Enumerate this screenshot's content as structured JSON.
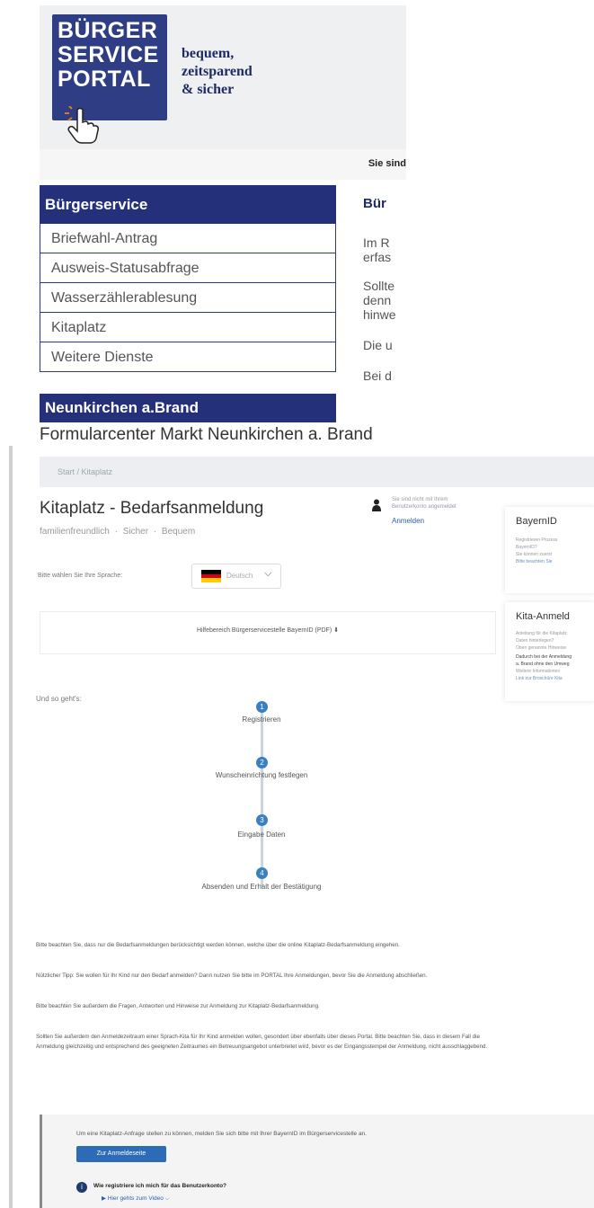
{
  "portal": {
    "logo": {
      "line1": "BÜRGER",
      "line2": "SERVICE",
      "line3": "PORTAL"
    },
    "tagline": [
      "bequem,",
      "zeitsparend",
      "& sicher"
    ],
    "user_hint": "Sie sind",
    "sidebar": {
      "heading": "Bürgerservice",
      "items": [
        {
          "label": "Briefwahl-Antrag"
        },
        {
          "label": "Ausweis-Statusabfrage"
        },
        {
          "label": "Wasserzählerablesung"
        },
        {
          "label": "Kitaplatz"
        },
        {
          "label": "Weitere Dienste"
        }
      ],
      "section2": "Neunkirchen a.Brand"
    },
    "content": {
      "title": "Bür",
      "p1": [
        "Im R",
        "erfas"
      ],
      "p2": [
        "Sollte",
        "denn",
        "hinwe"
      ],
      "p3": "Die u",
      "p4": "Bei d"
    }
  },
  "formularcenter": {
    "header": "Formularcenter Markt Neunkirchen a. Brand",
    "breadcrumb": "Start / Kitaplatz",
    "title": "Kitaplatz - Bedarfsanmeldung",
    "subtitle": "familienfreundlich · Sicher · Bequem",
    "login": {
      "line1": "Sie sind nicht mit Ihrem",
      "line2": "Benutzerkonto angemeldet",
      "link": "Anmelden"
    },
    "language": {
      "label": "Bitte wählen Sie Ihre Sprache:",
      "value": "Deutsch",
      "chevron": "⌵"
    },
    "help_link": "Hilfebereich Bürgerservicestelle BayernID (PDF) ⬇",
    "steps_intro": "Und so geht's:",
    "steps": [
      {
        "num": "1",
        "label": "Registrieren"
      },
      {
        "num": "2",
        "label": "Wunscheinrichtung festlegen"
      },
      {
        "num": "3",
        "label": "Eingabe Daten"
      },
      {
        "num": "4",
        "label": "Absenden und Erhalt der Bestätigung"
      }
    ],
    "paragraphs": [
      "Bitte beachten Sie, dass nur die Bedarfsanmeldungen berücksichtigt werden können, welche über die online Kitaplatz-Bedarfsanmeldung eingehen.",
      "Nützlicher Tipp: Sie wollen für Ihr Kind nur den Bedarf anmelden? Dann nutzen Sie bitte im PORTAL Ihre Anmeldungen, bevor Sie die Anmeldung abschließen.",
      "Bitte beachten Sie außerdem die Fragen, Antworten und Hinweise zur Anmeldung zur Kitaplatz-Bedarfsanmeldung.",
      "Sollten Sie außerdem den Anmeldezeitraum einer Sprach-Kita für Ihr Kind anmelden wollen, gesondert über ebenfalls über dieses Portal. Bitte beachten Sie, dass in diesem Fall die Anmeldung gleichzeitig und entsprechend des geeigneten Zeitraumes ein Betreuungsangebot unterbreitet wird, bevor es der Eingangsstempel der Anmeldung, nicht ausschlaggebend."
    ],
    "login_panel": {
      "prompt": "Um eine Kitaplatz-Anfrage stellen zu können, melden Sie sich bitte mit Ihrer BayernID im Bürgerservicestelle an.",
      "button": "Zur Anmeldeseite",
      "faq_icon": "i",
      "faq_question": "Wie registriere ich mich für das Benutzerkonto?",
      "faq_video": "▶ Hier gehts zum Video ⌵"
    },
    "cards": [
      {
        "title": "BayernID",
        "lines": [
          "Registrieren Prozess",
          "BayernID?",
          "Sie können zuerst",
          "Bitte beachten Sie"
        ]
      },
      {
        "title": "Kita-Anmeld",
        "lines": [
          "Anleitung für die Kitaplatz",
          "Daten hinterlegen?",
          "Oben genannte Hinweise",
          "Dadurch bei der Anmeldung",
          "a. Brand ohne den Umweg",
          "Weitere Informationen",
          "Link zur Broschüre Kita"
        ]
      }
    ]
  },
  "colors": {
    "portal_blue": "#25307a",
    "link_blue": "#2a5db0",
    "step_blue": "#3a7fc2",
    "button_blue": "#2d6bb6"
  }
}
